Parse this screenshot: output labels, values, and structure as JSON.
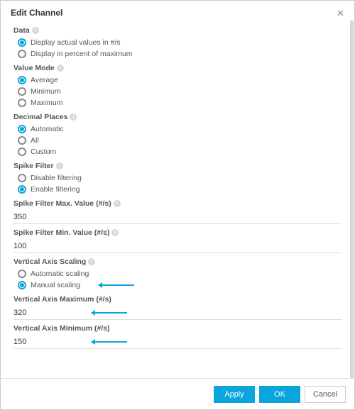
{
  "dialog": {
    "title": "Edit Channel"
  },
  "sections": {
    "data": {
      "label": "Data",
      "opt_actual": "Display actual values in #/s",
      "opt_percent": "Display in percent of maximum"
    },
    "value_mode": {
      "label": "Value Mode",
      "opt_average": "Average",
      "opt_minimum": "Minimum",
      "opt_maximum": "Maximum"
    },
    "decimal": {
      "label": "Decimal Places",
      "opt_auto": "Automatic",
      "opt_all": "All",
      "opt_custom": "Custom"
    },
    "spike": {
      "label": "Spike Filter",
      "opt_disable": "Disable filtering",
      "opt_enable": "Enable filtering"
    },
    "spike_max": {
      "label": "Spike Filter Max. Value (#/s)",
      "value": "350"
    },
    "spike_min": {
      "label": "Spike Filter Min. Value (#/s)",
      "value": "100"
    },
    "vaxis": {
      "label": "Vertical Axis Scaling",
      "opt_auto": "Automatic scaling",
      "opt_manual": "Manual scaling"
    },
    "vaxis_max": {
      "label": "Vertical Axis Maximum (#/s)",
      "value": "320"
    },
    "vaxis_min": {
      "label": "Vertical Axis Minimum (#/s)",
      "value": "150"
    }
  },
  "buttons": {
    "apply": "Apply",
    "ok": "OK",
    "cancel": "Cancel"
  }
}
